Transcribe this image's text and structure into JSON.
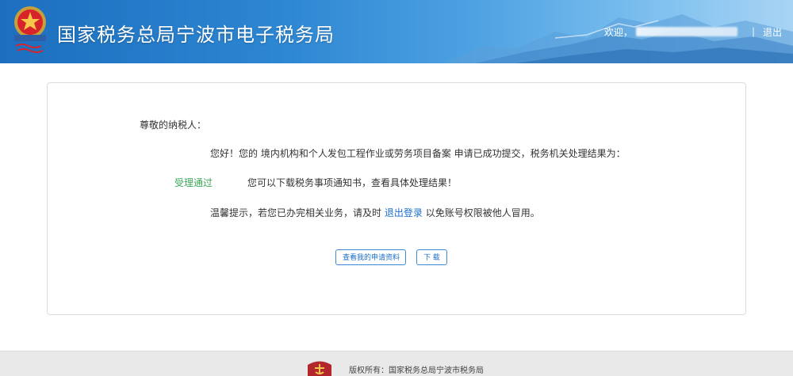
{
  "header": {
    "site_title": "国家税务总局宁波市电子税务局",
    "welcome": "欢迎，",
    "separator": "|",
    "logout": "退出",
    "colors": {
      "header_blue": "#1c6fbe",
      "header_light": "#a8d4f4"
    }
  },
  "notice": {
    "greeting": "尊敬的纳税人：",
    "line1": "您好！您的 境内机构和个人发包工程作业或劳务项目备案 申请已成功提交，税务机关处理结果为：",
    "status": "受理通过",
    "line2": "您可以下载税务事项通知书，查看具体处理结果！",
    "line3_prefix": "温馨提示，若您已办完相关业务，请及时",
    "line3_link": "退出登录",
    "line3_suffix": "以免账号权限被他人冒用。",
    "status_color": "#3aa65a",
    "link_color": "#1a6fc9"
  },
  "buttons": {
    "view_materials": "查看我的申请资料",
    "download": "下 载"
  },
  "footer": {
    "copyright": "版权所有：国家税务总局宁波市税务局"
  },
  "icons": {
    "emblem": "tax-emblem-icon",
    "footer_badge": "tax-badge-icon"
  }
}
